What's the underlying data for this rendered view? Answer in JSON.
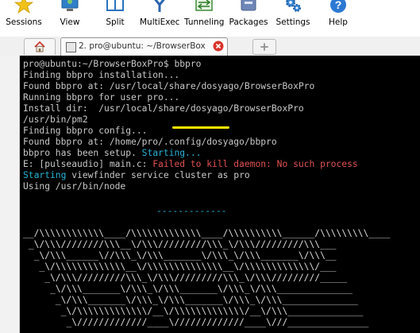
{
  "toolbar": [
    {
      "id": "sessions",
      "label": "Sessions",
      "icon": "star-icon"
    },
    {
      "id": "view",
      "label": "View",
      "icon": "monitor-user-icon"
    },
    {
      "id": "split",
      "label": "Split",
      "icon": "split-window-icon"
    },
    {
      "id": "multiexec",
      "label": "MultiExec",
      "icon": "multiexec-icon"
    },
    {
      "id": "tunneling",
      "label": "Tunneling",
      "icon": "tunneling-icon"
    },
    {
      "id": "packages",
      "label": "Packages",
      "icon": "packages-icon"
    },
    {
      "id": "settings",
      "label": "Settings",
      "icon": "gear-icon"
    },
    {
      "id": "help",
      "label": "Help",
      "icon": "help-icon"
    }
  ],
  "tabs": {
    "active_label": "2. pro@ubuntu: ~/BrowserBoxPro"
  },
  "terminal": {
    "prompt": "pro@ubuntu:~/BrowserBoxPro$ ",
    "command": "bbpro",
    "lines": {
      "l1": "Finding bbpro installation...",
      "l2": "Found bbpro at: /usr/local/share/dosyago/BrowserBoxPro",
      "l3": "Running bbpro for user pro...",
      "l4": "Install dir:  /usr/local/share/dosyago/BrowserBoxPro",
      "l5": "/usr/bin/pm2",
      "l6": "Finding bbpro config...",
      "l7": "Found bbpro at: /home/pro/.config/dosyago/bbpro",
      "l8a": "bbpro has been setup. ",
      "l8b": "Starting...",
      "l9a": "E: [pulseaudio] main.c: ",
      "l9b": "Failed to kill daemon: No such process",
      "l10a": "Starting",
      "l10b": " viewfinder service cluster as pro",
      "l11": "Using /usr/bin/node",
      "separator": "-------------"
    },
    "ascii_art": [
      "__/\\\\\\\\\\\\\\\\\\\\\\\\____/\\\\\\\\\\\\\\\\\\\\\\\\\\____/\\\\\\\\\\\\\\\\\\\\______/\\\\\\\\\\\\\\\\\\____",
      " _\\/\\\\\\////////\\\\\\__\\/\\\\\\/////////\\\\\\_\\/\\\\\\/////////\\\\\\___",
      "  _\\/\\\\\\______\\//\\\\\\_\\/\\\\\\_______\\/\\\\\\_\\/\\\\\\_______\\/\\\\\\__",
      "   _\\/\\\\\\\\\\\\\\\\\\\\\\\\\\__\\/\\\\\\\\\\\\\\\\\\\\\\\\\\\\__\\/\\\\\\\\\\\\\\\\\\\\\\\\\\/___",
      "    _\\/\\\\\\/////////\\\\\\_\\/\\\\\\/////////\\\\\\_\\/\\\\\\/////////_____",
      "     _\\/\\\\\\_______\\/\\\\\\_\\/\\\\\\_______\\/\\\\\\_\\/\\\\\\______________",
      "      _\\/\\\\\\_______\\/\\\\\\_\\/\\\\\\_______\\/\\\\\\_\\/\\\\\\______________",
      "       _\\/\\\\\\\\\\\\\\\\\\\\\\\\\\/__\\/\\\\\\\\\\\\\\\\\\\\\\\\\\/__\\/\\\\\\______________",
      "        _\\/////////////____\\/////////////____\\///_______________"
    ]
  }
}
